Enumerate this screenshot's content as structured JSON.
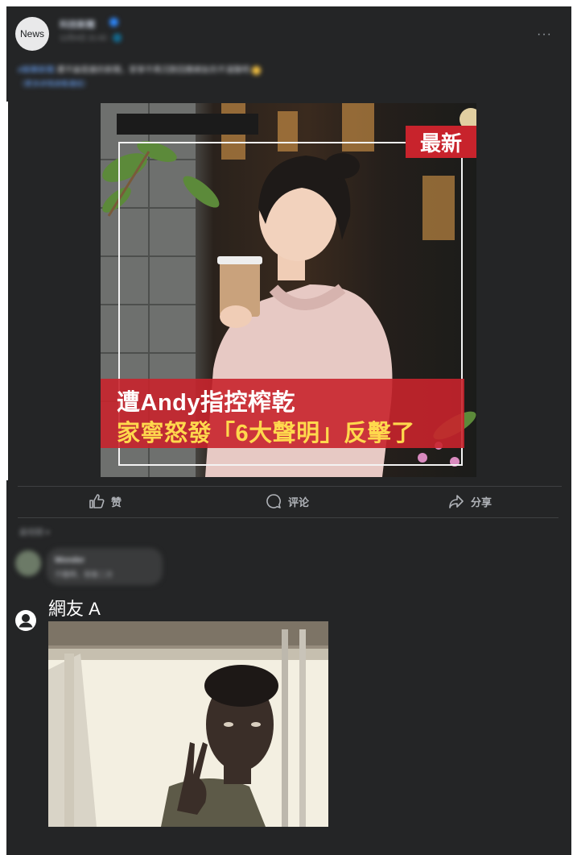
{
  "post": {
    "avatar_text": "News",
    "author": "科技新聞",
    "meta": "12月4日 21:43 · 🌐",
    "more": "···",
    "caption_tag": "#娛樂新聞",
    "caption": " 遭不論是誰的新聞，家寧不再沉默回應網友的不滿聲明",
    "caption_link": "（更多詳情請看連結）"
  },
  "post_image": {
    "badge": "最新",
    "headline_line1": "遭Andy指控榨乾",
    "headline_line2": "家寧怒發「6大聲明」反擊了"
  },
  "actions": {
    "like": "赞",
    "comment": "评论",
    "share": "分享"
  },
  "comments": {
    "sort_label": "最相關 ▾",
    "items": [
      {
        "name": "Wonder",
        "text": "不醜啊，很像二次"
      }
    ]
  },
  "reply": {
    "user_name": "網友 A"
  },
  "colors": {
    "panel": "#242526",
    "badge_red": "#c8232c",
    "headline_yellow": "#ffd84d",
    "link_blue": "#6ea8fe"
  }
}
